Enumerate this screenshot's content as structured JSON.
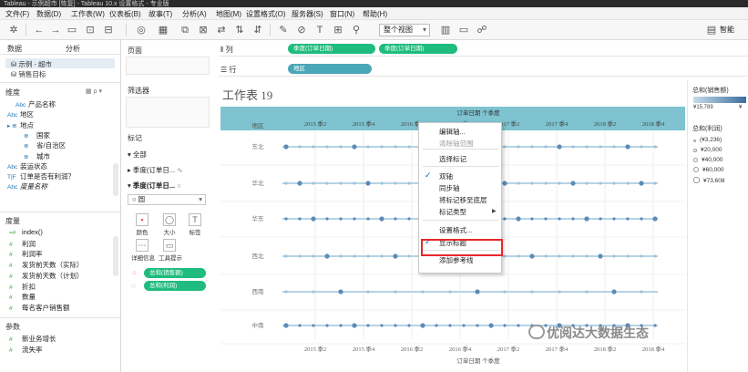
{
  "window": {
    "title": "Tableau - 示例超市 [恢复] - Tableau 10.x 设置格式 - 专业版"
  },
  "menu": [
    "文件(F)",
    "数据(D)",
    "工作表(W)",
    "仪表板(B)",
    "故事(T)",
    "分析(A)",
    "地图(M)",
    "设置格式(O)",
    "服务器(S)",
    "窗口(N)",
    "帮助(H)"
  ],
  "toolbar": {
    "view_select": "整个视图",
    "smart_btn": "智能"
  },
  "datapane": {
    "tabs": [
      "数据",
      "分析"
    ],
    "sources": [
      "示例 - 超市",
      "销售目标"
    ],
    "dimensions_label": "维度",
    "dimensions": [
      {
        "pre": "Abc",
        "name": "产品名称",
        "indent": 1
      },
      {
        "pre": "Abc",
        "name": "地区",
        "indent": 0
      },
      {
        "pre": "▸ ⊕",
        "name": "地点",
        "indent": 0
      },
      {
        "pre": "⊕",
        "name": "国家",
        "indent": 2
      },
      {
        "pre": "⊕",
        "name": "省/自治区",
        "indent": 2
      },
      {
        "pre": "⊕",
        "name": "城市",
        "indent": 2
      },
      {
        "pre": "Abc",
        "name": "装运状态",
        "indent": 0
      },
      {
        "pre": "T|F",
        "name": "订单是否有利润？",
        "indent": 0
      },
      {
        "pre": "Abc",
        "name": "度量名称",
        "indent": 0
      }
    ],
    "measures_label": "度量",
    "measures": [
      "index()",
      "利润",
      "利润率",
      "发货前天数（实际）",
      "发货前天数（计划）",
      "折扣",
      "数量",
      "每名客户销售额"
    ],
    "params_label": "参数",
    "params": [
      "新业务增长",
      "流失率"
    ]
  },
  "cards": {
    "pages": "页面",
    "filters": "筛选器",
    "marks": "标记",
    "marks_rows": [
      "全部",
      "季度(订单日...",
      "季度(订单日..."
    ],
    "mark_type": "圆",
    "buttons": [
      "颜色",
      "大小",
      "标签",
      "详细信息",
      "工具提示"
    ],
    "pills": [
      "总和(销售额)",
      "总和(利润)"
    ]
  },
  "shelves": {
    "columns_label": "列",
    "columns_pills": [
      "季度(订单日期)",
      "季度(订单日期)"
    ],
    "rows_label": "行",
    "rows_pills": [
      "地区"
    ]
  },
  "viz": {
    "title": "工作表 19",
    "axis_top_title": "订单日期 个季度",
    "axis_bottom_title": "订单日期 个季度",
    "row_header": "地区",
    "col_ticks": [
      "2015 季2",
      "2015 季4",
      "2016 季2",
      "2016 季4",
      "2017 季2",
      "2017 季4",
      "2018 季2",
      "2018 季4"
    ],
    "regions": [
      "东北",
      "华北",
      "华东",
      "西北",
      "西南",
      "中南"
    ]
  },
  "legend": {
    "color_title": "总和(销售额)",
    "color_range": [
      "¥15,789",
      "¥"
    ],
    "size_title": "总和(利润)",
    "size_items": [
      "(¥3,236)",
      "¥20,000",
      "¥40,000",
      "¥60,000",
      "¥73,608"
    ]
  },
  "context_menu": {
    "items": [
      {
        "label": "编辑轴...",
        "disabled": false,
        "checked": false,
        "sub": false
      },
      {
        "label": "清除轴范围",
        "disabled": true,
        "checked": false,
        "sub": false
      },
      {
        "label": "选择标记",
        "disabled": false,
        "checked": false,
        "sub": false
      },
      {
        "label": "双轴",
        "disabled": false,
        "checked": true,
        "sub": false
      },
      {
        "label": "同步轴",
        "disabled": false,
        "checked": false,
        "sub": false
      },
      {
        "label": "将标记移至底层",
        "disabled": false,
        "checked": false,
        "sub": false
      },
      {
        "label": "标记类型",
        "disabled": false,
        "checked": false,
        "sub": true
      },
      {
        "label": "设置格式...",
        "disabled": false,
        "checked": false,
        "sub": false
      },
      {
        "label": "显示标题",
        "disabled": false,
        "checked": true,
        "sub": false
      },
      {
        "label": "添加参考线",
        "disabled": false,
        "checked": false,
        "sub": false
      }
    ]
  },
  "watermark": "优阅达大数据生态",
  "colors": {
    "green_pill": "#1ebc7e",
    "teal_header": "#7ec3cf",
    "dot_dark": "#3b6e9e",
    "highlight": "#e8272a"
  }
}
